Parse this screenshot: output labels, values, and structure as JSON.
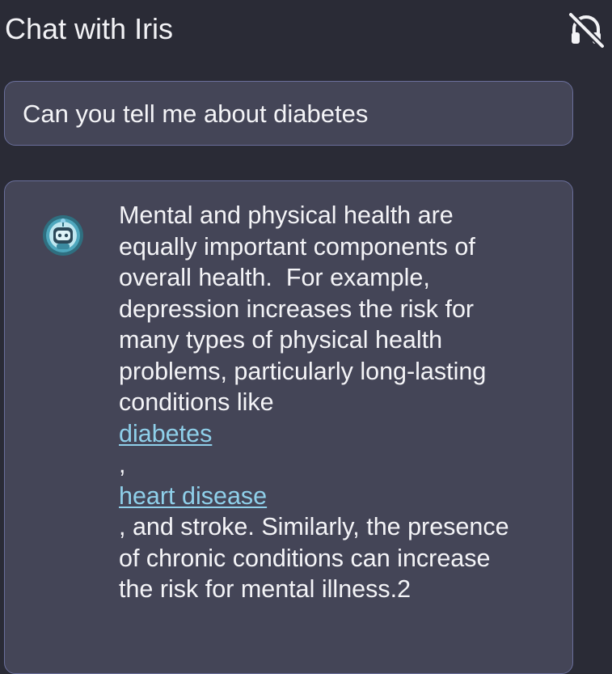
{
  "header": {
    "title": "Chat with Iris",
    "audio_toggle_icon": "headphones-off-icon"
  },
  "colors": {
    "background": "#2a2b36",
    "bubble_background": "#444557",
    "bubble_border": "#6a6f9b",
    "link": "#8fd0ea",
    "text": "#f4f4f7"
  },
  "messages": {
    "user": {
      "text": "Can you tell me about diabetes"
    },
    "bot": {
      "avatar_icon": "robot-avatar-icon",
      "intro_lines": [
        "Mental and physical health are",
        "equally important components of",
        "overall health.  For example,",
        "depression increases the risk for",
        "many types of physical health",
        "problems, particularly long-lasting",
        "conditions like"
      ],
      "link_1": "diabetes",
      "separator": ",",
      "link_2": "heart disease",
      "outro_lines": [
        ", and stroke. Similarly, the presence",
        "of chronic conditions can increase",
        "the risk for mental illness.2"
      ]
    }
  }
}
